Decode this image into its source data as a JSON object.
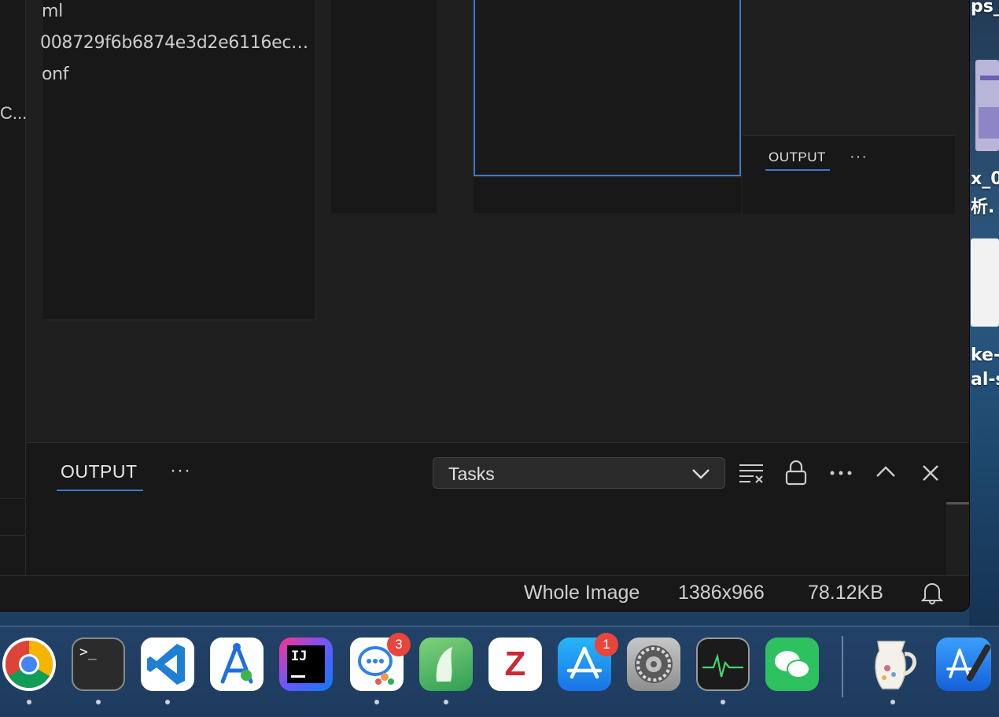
{
  "desktop": {
    "labels": [
      "ps_",
      "x_0",
      "析.",
      "ke-",
      "al-s"
    ]
  },
  "explorer": {
    "lines": [
      "ml",
      "008729f6b6874e3d2e6116ec…",
      "onf"
    ],
    "left_truncated": "C..."
  },
  "secondary_panel": {
    "tab_label": "OUTPUT",
    "more_label": "···"
  },
  "output_panel": {
    "tab_label": "OUTPUT",
    "more_label": "···",
    "select_value": "Tasks"
  },
  "status_bar": {
    "mode": "Whole Image",
    "dimensions": "1386x966",
    "size": "78.12KB"
  },
  "dock": {
    "apps": [
      {
        "name": "chrome",
        "running": true
      },
      {
        "name": "terminal",
        "running": true,
        "glyph": ">_"
      },
      {
        "name": "vscode",
        "running": true
      },
      {
        "name": "instruments",
        "running": false
      },
      {
        "name": "intellij",
        "running": false,
        "glyph": "IJ"
      },
      {
        "name": "chat",
        "running": true,
        "badge": "3"
      },
      {
        "name": "maps-bird",
        "running": true
      },
      {
        "name": "zotero",
        "running": false,
        "glyph": "Z"
      },
      {
        "name": "app-store",
        "running": false,
        "badge": "1"
      },
      {
        "name": "system-settings",
        "running": false
      },
      {
        "name": "activity-monitor",
        "running": true
      },
      {
        "name": "wechat",
        "running": false
      },
      {
        "name": "pitcher",
        "running": true
      },
      {
        "name": "xcode",
        "running": false
      }
    ]
  },
  "colors": {
    "accent": "#3f77c6",
    "badge": "#e8453c"
  }
}
